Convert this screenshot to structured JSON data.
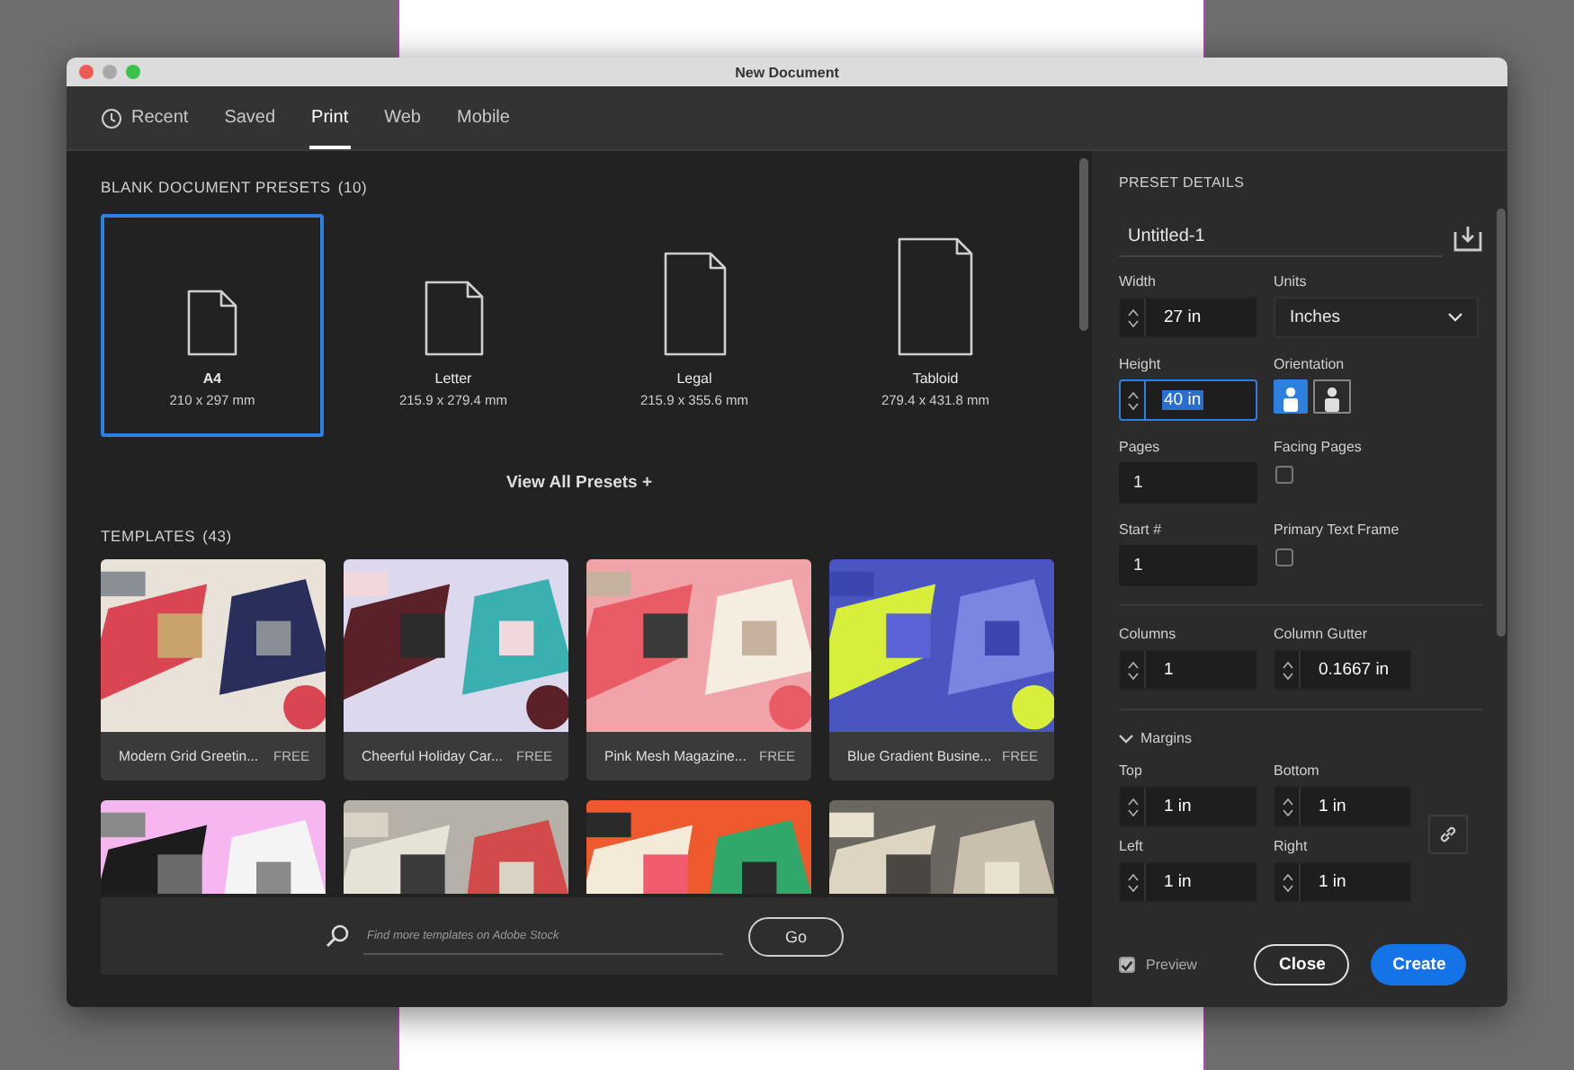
{
  "window": {
    "title": "New Document"
  },
  "tabs": [
    {
      "label": "Recent",
      "kind": "history",
      "selected": false
    },
    {
      "label": "Saved",
      "kind": "plain",
      "selected": false
    },
    {
      "label": "Print",
      "kind": "plain",
      "selected": true
    },
    {
      "label": "Web",
      "kind": "plain",
      "selected": false
    },
    {
      "label": "Mobile",
      "kind": "plain",
      "selected": false
    }
  ],
  "presets": {
    "heading": "BLANK DOCUMENT PRESETS",
    "count": "(10)",
    "view_all": "View All Presets",
    "view_all_icon": "+",
    "items": [
      {
        "name": "A4",
        "size": "210 x 297 mm",
        "selected": true
      },
      {
        "name": "Letter",
        "size": "215.9 x 279.4 mm",
        "selected": false
      },
      {
        "name": "Legal",
        "size": "215.9 x 355.6 mm",
        "selected": false
      },
      {
        "name": "Tabloid",
        "size": "279.4 x 431.8 mm",
        "selected": false
      }
    ]
  },
  "templates": {
    "heading": "TEMPLATES",
    "count": "(43)",
    "items": [
      {
        "kind": "card",
        "name": "Modern Grid Greetin...",
        "badge": "FREE"
      },
      {
        "kind": "card",
        "name": "Cheerful Holiday Car...",
        "badge": "FREE"
      },
      {
        "kind": "card",
        "name": "Pink Mesh Magazine...",
        "badge": "FREE"
      },
      {
        "kind": "card",
        "name": "Blue Gradient Busine...",
        "badge": "FREE"
      },
      {
        "kind": "picture"
      },
      {
        "kind": "picture"
      },
      {
        "kind": "picture"
      },
      {
        "kind": "picture"
      }
    ],
    "search": {
      "placeholder": "Find more templates on Adobe Stock",
      "button": "Go"
    }
  },
  "details": {
    "heading": "PRESET DETAILS",
    "name": "Untitled-1",
    "width": {
      "label": "Width",
      "value": "27 in",
      "focused": false
    },
    "units": {
      "label": "Units",
      "value": "Inches"
    },
    "height": {
      "label": "Height",
      "value": "40 in",
      "focused": true
    },
    "orientation": {
      "label": "Orientation",
      "items": [
        {
          "kind": "portrait",
          "selected": true
        },
        {
          "kind": "landscape",
          "selected": false
        }
      ]
    },
    "pages": {
      "label": "Pages",
      "value": "1"
    },
    "facing_pages": {
      "label": "Facing Pages",
      "checked": false
    },
    "start": {
      "label": "Start #",
      "value": "1"
    },
    "primary_text_frame": {
      "label": "Primary Text Frame",
      "checked": false
    },
    "columns": {
      "label": "Columns",
      "value": "1",
      "focused": false
    },
    "column_gutter": {
      "label": "Column Gutter",
      "value": "0.1667 in",
      "focused": false
    },
    "margins": {
      "label": "Margins",
      "expanded": true,
      "top": {
        "label": "Top",
        "value": "1 in",
        "focused": false
      },
      "bottom": {
        "label": "Bottom",
        "value": "1 in",
        "focused": false
      },
      "left": {
        "label": "Left",
        "value": "1 in",
        "focused": false
      },
      "right": {
        "label": "Right",
        "value": "1 in",
        "focused": false
      }
    },
    "preview": {
      "label": "Preview",
      "checked": true
    },
    "buttons": {
      "close": "Close",
      "create": "Create"
    }
  }
}
